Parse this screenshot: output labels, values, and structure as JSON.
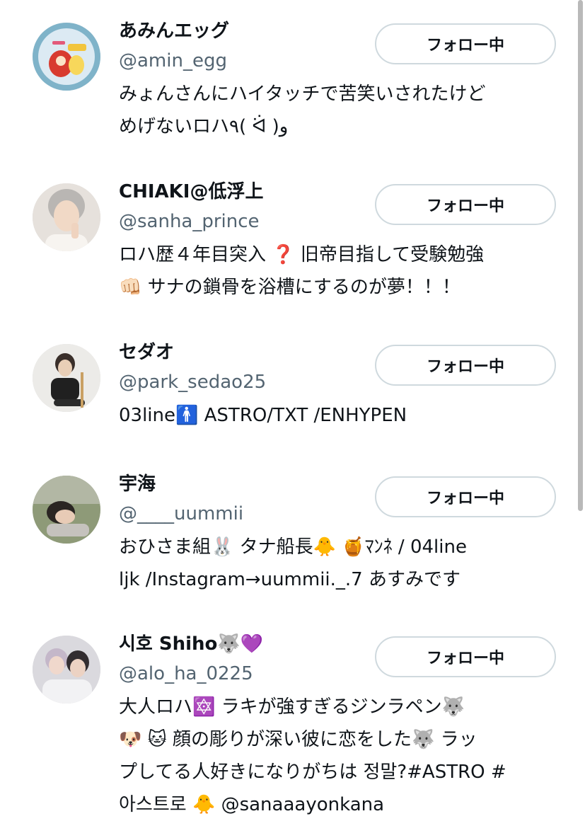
{
  "follow_button_label": "フォロー中",
  "users": [
    {
      "name": "あみんエッグ",
      "handle": "@amin_egg",
      "bio_lines": [
        "みょんさんにハイタッチで苦笑いされたけど",
        "めげないロハ٩( ᐛ )و"
      ],
      "avatar_icon": "avatar-amin-egg"
    },
    {
      "name": "CHIAKI@低浮上",
      "handle": "@sanha_prince",
      "bio_lines": [
        "ロハ歴４年目突入 ❓ 旧帝目指して受験勉強",
        "👊🏻 サナの鎖骨を浴槽にするのが夢！！！"
      ],
      "avatar_icon": "avatar-chiaki"
    },
    {
      "name": "セダオ",
      "handle": "@park_sedao25",
      "bio_lines": [
        "03line🚹 ASTRO/TXT /ENHYPEN"
      ],
      "avatar_icon": "avatar-sedao"
    },
    {
      "name": "宇海",
      "handle": "@____uummii",
      "bio_lines": [
        "おひさま組🐰 タナ船長🐥 🍯ﾏﾝﾈ / 04line",
        "ljk /Instagram→uummii._.7 あすみです"
      ],
      "avatar_icon": "avatar-uummii"
    },
    {
      "name": "시호 Shiho🐺💜",
      "handle": "@alo_ha_0225",
      "bio_lines": [
        "大人ロハ🔯 ラキが強すぎるジンラペン🐺",
        "🐶 🐱 顔の彫りが深い彼に恋をした🐺 ラッ",
        "プしてる人好きになりがちは 정말?#ASTRO #",
        "아스트로 🐥 @sanaaayonkana"
      ],
      "avatar_icon": "avatar-shiho"
    }
  ]
}
